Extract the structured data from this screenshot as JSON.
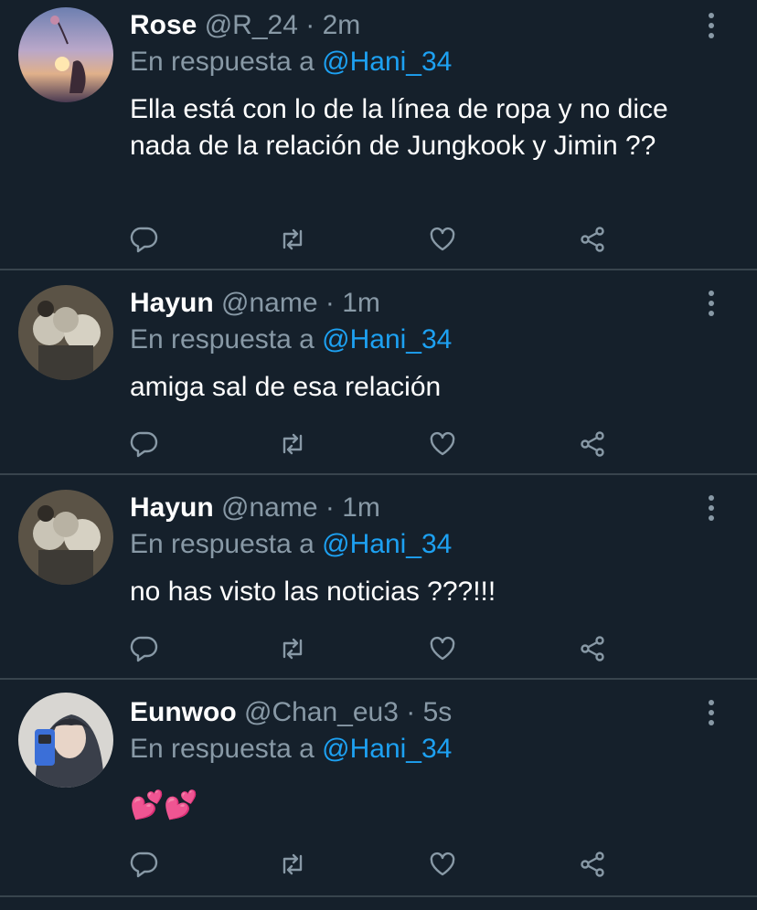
{
  "tweets": [
    {
      "name": "Rose",
      "handle": "@R_24",
      "sep": "·",
      "time": "2m",
      "reply_prefix": "En respuesta a",
      "reply_to": "@Hani_34",
      "text": "Ella está con lo de la línea de ropa y no dice nada de la relación de Jungkook y Jimin ??"
    },
    {
      "name": "Hayun",
      "handle": "@name",
      "sep": "·",
      "time": "1m",
      "reply_prefix": "En respuesta a",
      "reply_to": "@Hani_34",
      "text": "amiga sal de esa relación"
    },
    {
      "name": "Hayun",
      "handle": "@name",
      "sep": "·",
      "time": "1m",
      "reply_prefix": "En respuesta a",
      "reply_to": "@Hani_34",
      "text": "no has visto las noticias ???!!!"
    },
    {
      "name": "Eunwoo",
      "handle": "@Chan_eu3",
      "sep": "·",
      "time": "5s",
      "reply_prefix": "En respuesta a",
      "reply_to": "@Hani_34",
      "text": "💕💕"
    }
  ],
  "icons": {
    "reply": "comment-icon",
    "retweet": "retweet-icon",
    "like": "heart-icon",
    "share": "share-icon",
    "more": "more-vertical-icon"
  },
  "colors": {
    "background": "#15202b",
    "divider": "#38444d",
    "muted": "#8899a6",
    "link": "#1da1f2"
  }
}
